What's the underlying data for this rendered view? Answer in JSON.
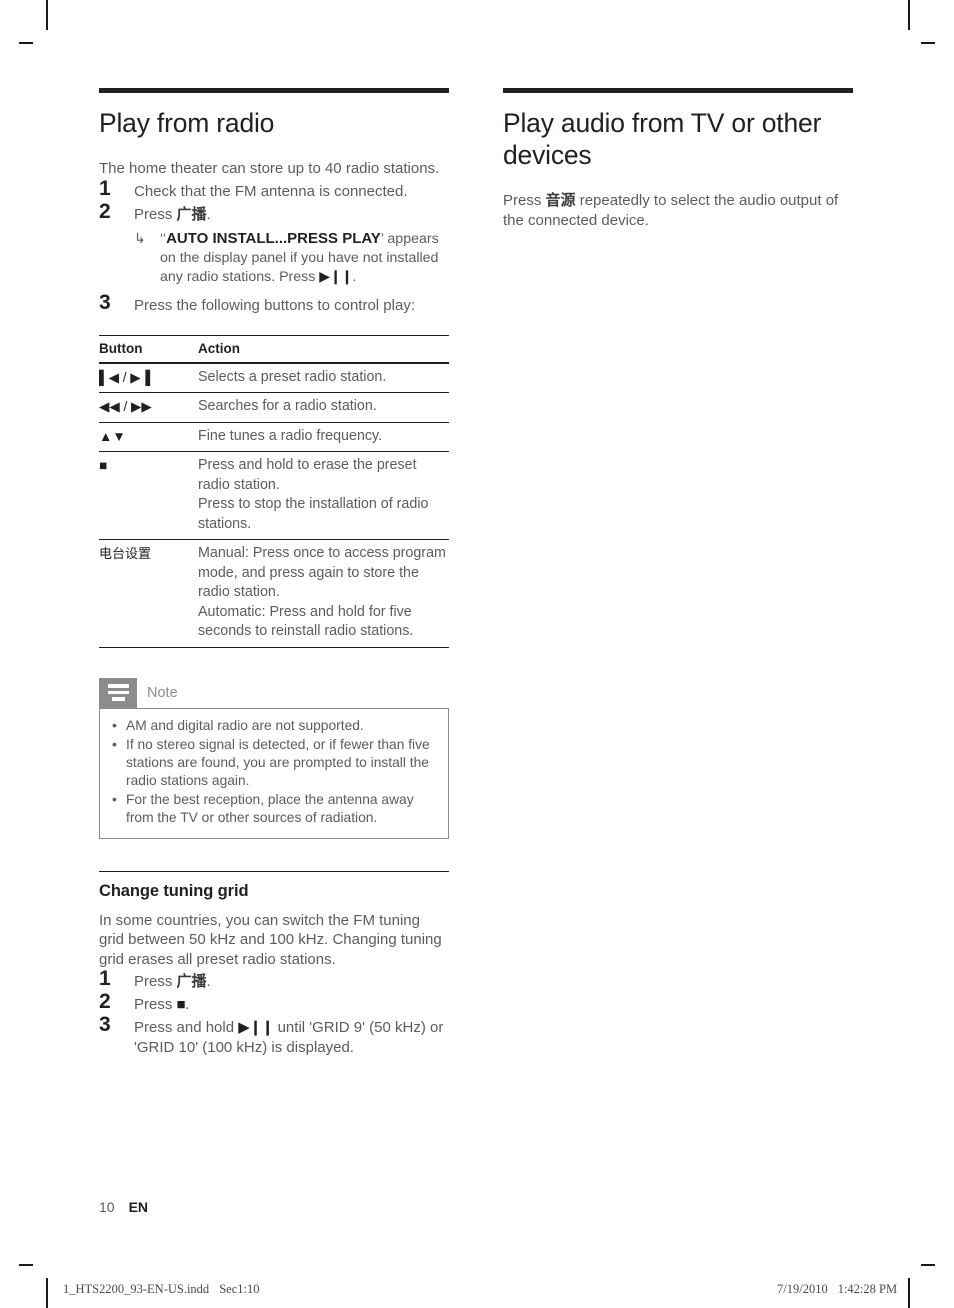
{
  "left_column": {
    "section": {
      "title": "Play from radio",
      "intro": "The home theater can store up to 40 radio stations.",
      "steps": [
        {
          "num": "1",
          "text": "Check that the FM antenna is connected."
        },
        {
          "num": "2",
          "text_prefix": "Press ",
          "text_cjk": "广播",
          "text_suffix": "."
        },
        {
          "num": "3",
          "text": "Press the following buttons to control play:"
        }
      ],
      "result": {
        "arrow_icon": "down-right-arrow-icon",
        "quote_open": "‘‘",
        "display_message": "AUTO INSTALL...PRESS PLAY",
        "quote_close": "’",
        "text_after": " appears on the display panel if you have not installed any radio stations. Press ",
        "play_pause_glyph": "▶❙❙",
        "period": "."
      }
    },
    "table": {
      "headers": [
        "Button",
        "Action"
      ],
      "rows": [
        {
          "button_glyph": "▌◀ / ▶▐",
          "button_type": "prev-next-icon",
          "action_lines": [
            "Selects a preset radio station."
          ]
        },
        {
          "button_glyph": "◀◀ / ▶▶",
          "button_type": "rewind-forward-icon",
          "action_lines": [
            "Searches for a radio station."
          ]
        },
        {
          "button_glyph": "▲▼",
          "button_type": "up-down-icon",
          "action_lines": [
            "Fine tunes a radio frequency."
          ]
        },
        {
          "button_glyph": "■",
          "button_type": "stop-icon",
          "action_lines": [
            "Press and hold to erase the preset radio station.",
            "Press to stop the installation of radio stations."
          ]
        },
        {
          "button_cjk": "电台设置",
          "button_type": "station-setting-button",
          "action_lines": [
            "Manual: Press once to access program mode, and press again to store the radio station.",
            "Automatic: Press and hold for five seconds to reinstall radio stations."
          ]
        }
      ]
    },
    "note": {
      "icon": "note-lines-icon",
      "label": "Note",
      "items": [
        "AM and digital radio are not supported.",
        "If no stereo signal is detected, or if fewer than five stations are found, you are prompted to install the radio stations again.",
        "For the best reception, place the antenna away from the TV or other sources of radiation."
      ]
    },
    "subsection": {
      "title": "Change tuning grid",
      "intro": "In some countries, you can switch the FM tuning grid between 50 kHz and 100 kHz. Changing tuning grid erases all preset radio stations.",
      "steps": [
        {
          "num": "1",
          "text_prefix": "Press ",
          "text_cjk": "广播",
          "text_suffix": "."
        },
        {
          "num": "2",
          "text_prefix": "Press ",
          "glyph": "■",
          "text_suffix": "."
        },
        {
          "num": "3",
          "text_prefix": "Press and hold ",
          "glyph": "▶❙❙",
          "text_suffix": " until 'GRID 9' (50 kHz) or 'GRID 10' (100 kHz) is displayed."
        }
      ]
    }
  },
  "right_column": {
    "section": {
      "title": "Play audio from TV or other devices",
      "body_prefix": "Press ",
      "body_cjk": "音源",
      "body_suffix": " repeatedly to select the audio output of the connected device."
    }
  },
  "footer": {
    "page_number": "10",
    "language": "EN"
  },
  "print_marks": {
    "file_name": "1_HTS2200_93-EN-US.indd",
    "section_page": "Sec1:10",
    "date": "7/19/2010",
    "time": "1:42:28 PM"
  },
  "colors": {
    "ink_black": "#231f20",
    "body_gray": "#5c5c5c",
    "note_gray": "#8c8c8c"
  }
}
